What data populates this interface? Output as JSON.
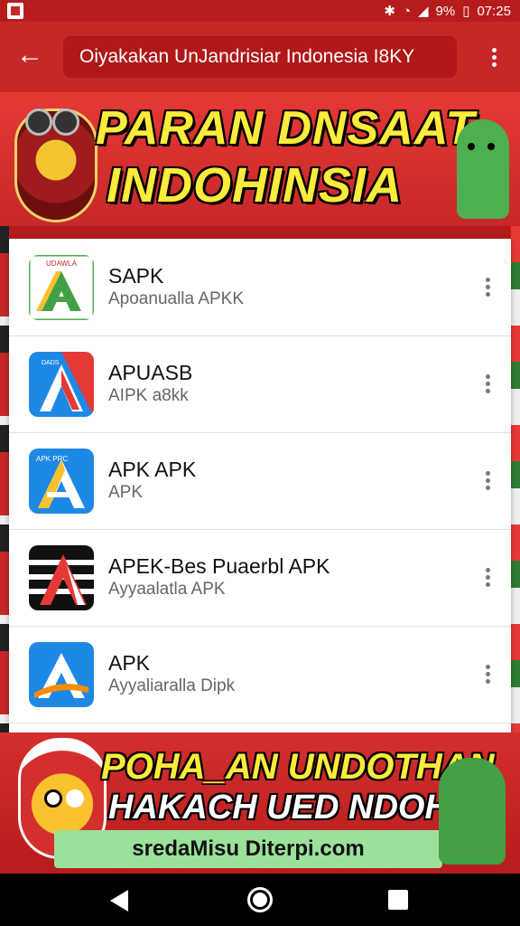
{
  "status_bar": {
    "battery": "9%",
    "time": "07:25"
  },
  "app_bar": {
    "title": "Oiyakakan UnJandrisiar Indonesia I8KY"
  },
  "top_banner": {
    "line1": "PARAN DNSAAT",
    "line2": "INDOHINSIA"
  },
  "apps": [
    {
      "name": "SAPK",
      "subtitle": "Apoanualla APKK",
      "icon": "green-a-icon",
      "icon_text": "UDAWLA"
    },
    {
      "name": "APUASB",
      "subtitle": "AIPK          a8kk",
      "icon": "red-a-icon",
      "icon_text": "DADS"
    },
    {
      "name": "APK APK",
      "subtitle": "APK",
      "icon": "blue-yellow-a-icon",
      "icon_text": "APK PRC"
    },
    {
      "name": "APEK-Bes Puaerbl APK",
      "subtitle": "Ayyaalatla APK",
      "icon": "black-red-a-icon",
      "icon_text": ""
    },
    {
      "name": "APK",
      "subtitle": "Ayyaliaralla Dipk",
      "icon": "blue-a-swoosh-icon",
      "icon_text": ""
    }
  ],
  "bottom_banner": {
    "line1": "POHA_AN UNDOTHAN",
    "line2": "HAKACH UED NDOHAN",
    "url": "sredaMisu Diterpi.com"
  },
  "colors": {
    "accent": "#c62828",
    "banner_text": "#ffeb3b"
  }
}
